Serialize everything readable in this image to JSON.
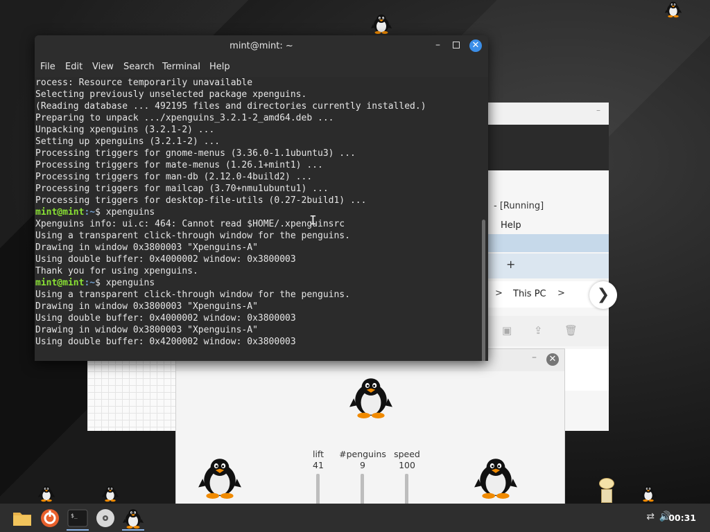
{
  "terminal": {
    "title": "mint@mint: ~",
    "menu": [
      "File",
      "Edit",
      "View",
      "Search",
      "Terminal",
      "Help"
    ],
    "lines": [
      {
        "t": "rocess: Resource temporarily unavailable"
      },
      {
        "t": "Selecting previously unselected package xpenguins."
      },
      {
        "t": "(Reading database ... 492195 files and directories currently installed.)"
      },
      {
        "t": "Preparing to unpack .../xpenguins_3.2.1-2_amd64.deb ..."
      },
      {
        "t": "Unpacking xpenguins (3.2.1-2) ..."
      },
      {
        "t": "Setting up xpenguins (3.2.1-2) ..."
      },
      {
        "t": "Processing triggers for gnome-menus (3.36.0-1.1ubuntu3) ..."
      },
      {
        "t": "Processing triggers for mate-menus (1.26.1+mint1) ..."
      },
      {
        "t": "Processing triggers for man-db (2.12.0-4build2) ..."
      },
      {
        "t": "Processing triggers for mailcap (3.70+nmu1ubuntu1) ..."
      },
      {
        "t": "Processing triggers for desktop-file-utils (0.27-2build1) ..."
      },
      {
        "prompt": true,
        "user": "mint@mint",
        "path": ":~",
        "cmd": "$ xpenguins"
      },
      {
        "t": "Xpenguins info: ui.c: 464: Cannot read $HOME/.xpenguinsrc"
      },
      {
        "t": "Using a transparent click-through window for the penguins."
      },
      {
        "t": "Drawing in window 0x3800003 \"Xpenguins-A\""
      },
      {
        "t": "Using double buffer: 0x4000002 window: 0x3800003"
      },
      {
        "t": "Thank you for using xpenguins."
      },
      {
        "prompt": true,
        "user": "mint@mint",
        "path": ":~",
        "cmd": "$ xpenguins"
      },
      {
        "t": "Using a transparent click-through window for the penguins."
      },
      {
        "t": "Drawing in window 0x3800003 \"Xpenguins-A\""
      },
      {
        "t": "Using double buffer: 0x4000002 window: 0x3800003"
      },
      {
        "t": "Drawing in window 0x3800003 \"Xpenguins-A\""
      },
      {
        "t": "Using double buffer: 0x4200002 window: 0x3800003"
      }
    ]
  },
  "vbox": {
    "title": "- [Running]",
    "menu_help": "Help",
    "tab_add": "+",
    "breadcrumb_sep": ">",
    "location": "This PC",
    "nav_next": "❯"
  },
  "xpenguins": {
    "sliders": [
      {
        "label": "lift",
        "value": "41"
      },
      {
        "label": "#penguins",
        "value": "9"
      },
      {
        "label": "speed",
        "value": "100"
      }
    ]
  },
  "taskbar": {
    "clock": "00:31",
    "apps": [
      "folder-icon",
      "software-manager-icon",
      "terminal-icon",
      "disc-icon",
      "penguin-icon"
    ]
  },
  "colors": {
    "prompt_user": "#8ae234",
    "prompt_path": "#729fcf",
    "close_accent": "#3b8ee8"
  }
}
